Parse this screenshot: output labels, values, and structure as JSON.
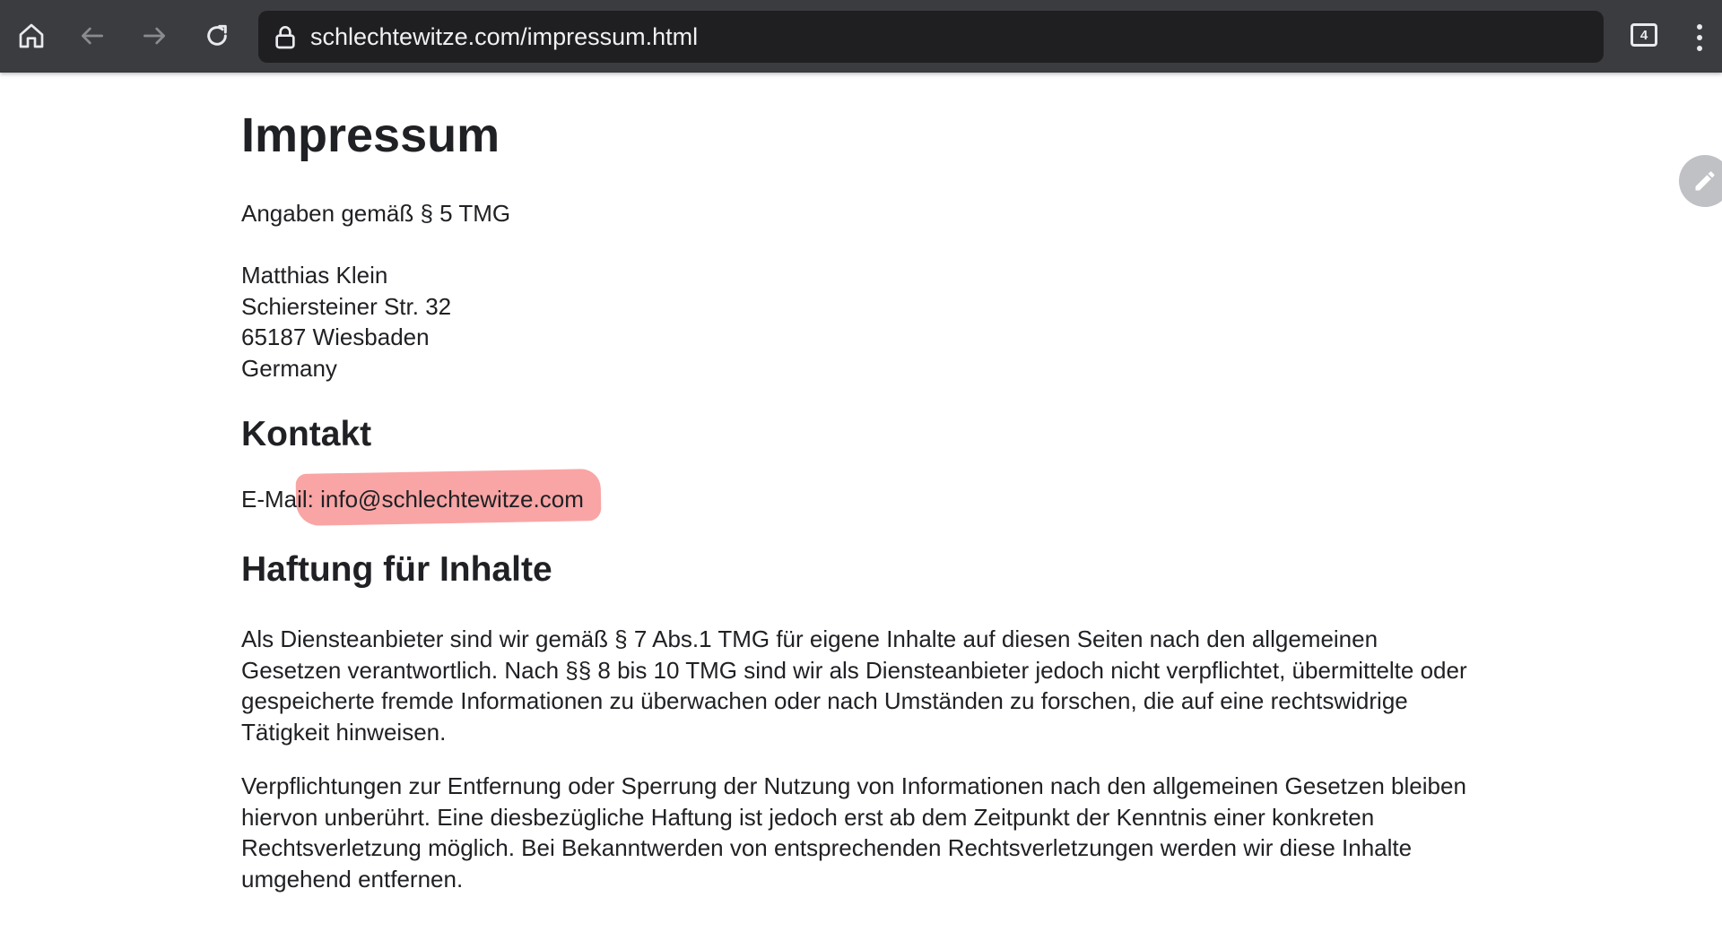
{
  "browser": {
    "url": "schlechtewitze.com/impressum.html",
    "tab_count": "4",
    "icons": [
      "home-icon",
      "back-icon",
      "forward-icon",
      "reload-icon",
      "lock-icon",
      "tabs-icon",
      "menu-icon"
    ]
  },
  "page": {
    "title": "Impressum",
    "tmg_line": "Angaben gemäß § 5 TMG",
    "address": {
      "name": "Matthias Klein",
      "street": "Schiersteiner Str. 32",
      "city": "65187 Wiesbaden",
      "country": "Germany"
    },
    "contact": {
      "heading": "Kontakt",
      "label": "E-Mail:",
      "email": "info@schlechtewitze.com"
    },
    "liability": {
      "heading": "Haftung für Inhalte",
      "paragraph1": [
        "Als Diensteanbieter sind wir gemäß § 7 Abs.1 TMG für eigene Inhalte auf diesen Seiten nach den allgemeinen",
        "Gesetzen verantwortlich. Nach §§ 8 bis 10 TMG sind wir als Diensteanbieter jedoch nicht verpflichtet, übermittelte oder",
        "gespeicherte fremde Informationen zu überwachen oder nach Umständen zu forschen, die auf eine rechtswidrige",
        "Tätigkeit hinweisen."
      ],
      "paragraph2": [
        "Verpflichtungen zur Entfernung oder Sperrung der Nutzung von Informationen nach den allgemeinen Gesetzen bleiben",
        "hiervon unberührt. Eine diesbezügliche Haftung ist jedoch erst ab dem Zeitpunkt der Kenntnis einer konkreten",
        "Rechtsverletzung möglich. Bei Bekanntwerden von entsprechenden Rechtsverletzungen werden wir diese Inhalte",
        "umgehend entfernen."
      ]
    }
  },
  "colors": {
    "toolbar": "#3b3c40",
    "urlbar": "#1f1f22",
    "highlight": "#f56e6e",
    "text": "#202124"
  }
}
